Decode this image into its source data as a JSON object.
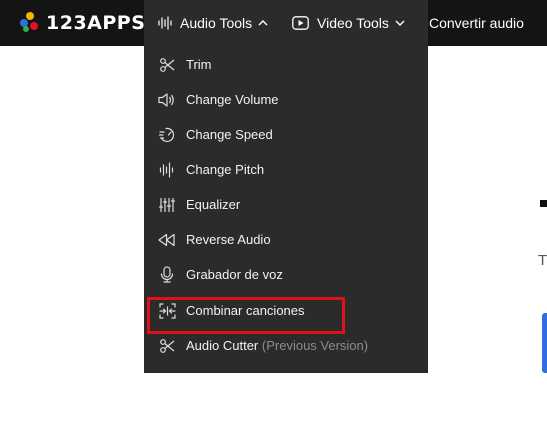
{
  "brand": {
    "name": "123APPS",
    "dot_colors": [
      "#f5b400",
      "#2f6fe0",
      "#e0112b",
      "#2fb04a"
    ]
  },
  "nav": {
    "audio_tools": "Audio Tools",
    "video_tools": "Video Tools",
    "convert_audio": "Convertir audio"
  },
  "menu": {
    "items": [
      {
        "label": "Trim",
        "icon": "scissors-icon"
      },
      {
        "label": "Change Volume",
        "icon": "speaker-icon"
      },
      {
        "label": "Change Speed",
        "icon": "speed-icon"
      },
      {
        "label": "Change Pitch",
        "icon": "waveform-icon"
      },
      {
        "label": "Equalizer",
        "icon": "equalizer-icon"
      },
      {
        "label": "Reverse Audio",
        "icon": "rewind-icon"
      },
      {
        "label": "Grabador de voz",
        "icon": "microphone-icon"
      },
      {
        "label": "Combinar canciones",
        "icon": "merge-icon"
      },
      {
        "label": "Audio Cutter",
        "suffix": "(Previous Version)",
        "icon": "scissors-icon"
      }
    ]
  },
  "page": {
    "partial_text": "T"
  },
  "colors": {
    "topbar": "#141414",
    "menu_bg": "#2b2b2b",
    "highlight": "#e0111b",
    "accent_blue": "#2f6fe0"
  }
}
